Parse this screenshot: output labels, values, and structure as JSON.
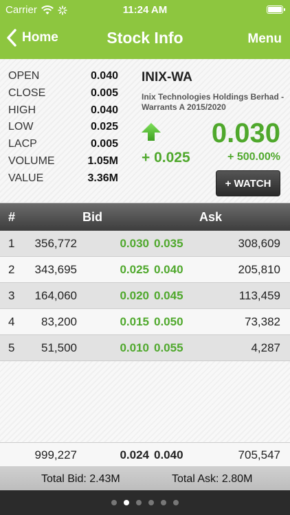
{
  "status_bar": {
    "carrier": "Carrier",
    "time": "11:24 AM"
  },
  "nav": {
    "back_label": "Home",
    "title": "Stock Info",
    "menu_label": "Menu"
  },
  "stats": [
    {
      "label": "OPEN",
      "value": "0.040"
    },
    {
      "label": "CLOSE",
      "value": "0.005"
    },
    {
      "label": "HIGH",
      "value": "0.040"
    },
    {
      "label": "LOW",
      "value": "0.025"
    },
    {
      "label": "LACP",
      "value": "0.005"
    },
    {
      "label": "VOLUME",
      "value": "1.05M"
    },
    {
      "label": "VALUE",
      "value": "3.36M"
    }
  ],
  "stock": {
    "symbol": "INIX-WA",
    "company": "Inix Technologies Holdings Berhad - Warrants A 2015/2020",
    "price": "0.030",
    "change": "+ 0.025",
    "change_pct": "+ 500.00%",
    "watch_label": "+ WATCH"
  },
  "table": {
    "headers": {
      "no": "#",
      "bid": "Bid",
      "ask": "Ask"
    },
    "rows": [
      {
        "no": "1",
        "bid_vol": "356,772",
        "bid": "0.030",
        "ask": "0.035",
        "ask_vol": "308,609"
      },
      {
        "no": "2",
        "bid_vol": "343,695",
        "bid": "0.025",
        "ask": "0.040",
        "ask_vol": "205,810"
      },
      {
        "no": "3",
        "bid_vol": "164,060",
        "bid": "0.020",
        "ask": "0.045",
        "ask_vol": "113,459"
      },
      {
        "no": "4",
        "bid_vol": "83,200",
        "bid": "0.015",
        "ask": "0.050",
        "ask_vol": "73,382"
      },
      {
        "no": "5",
        "bid_vol": "51,500",
        "bid": "0.010",
        "ask": "0.055",
        "ask_vol": "4,287"
      }
    ],
    "totals": {
      "bid_vol": "999,227",
      "bid": "0.024",
      "ask": "0.040",
      "ask_vol": "705,547"
    }
  },
  "summary": {
    "total_bid": "Total Bid: 2.43M",
    "total_ask": "Total Ask: 2.80M"
  },
  "pager": {
    "page_count": 6,
    "active_index": 1
  },
  "colors": {
    "brand_green": "#8dc63f",
    "price_green": "#4fa82c"
  }
}
